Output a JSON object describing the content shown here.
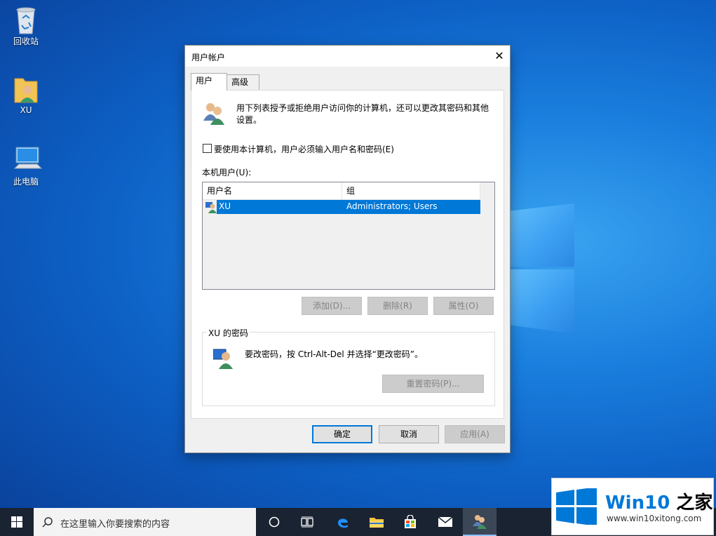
{
  "desktop": {
    "icons": [
      {
        "label": "回收站",
        "icon": "recycle-bin-icon"
      },
      {
        "label": "XU",
        "icon": "user-folder-icon"
      },
      {
        "label": "此电脑",
        "icon": "computer-icon"
      }
    ]
  },
  "dialog": {
    "title": "用户帐户",
    "close_glyph": "✕",
    "tabs": [
      {
        "label": "用户",
        "active": true
      },
      {
        "label": "高级",
        "active": false
      }
    ],
    "intro_text": "用下列表授予或拒绝用户访问你的计算机，还可以更改其密码和其他设置。",
    "require_password_checkbox": {
      "label": "要使用本计算机，用户必须输入用户名和密码(E)",
      "checked": false
    },
    "local_users_label": "本机用户(U):",
    "users_table": {
      "columns": [
        "用户名",
        "组"
      ],
      "rows": [
        {
          "username": "XU",
          "group": "Administrators; Users",
          "selected": true
        }
      ]
    },
    "user_buttons": {
      "add": "添加(D)...",
      "remove": "删除(R)",
      "properties": "属性(O)"
    },
    "password_group": {
      "title": "XU 的密码",
      "text": "要改密码，按 Ctrl-Alt-Del 并选择“更改密码”。",
      "reset_button": "重置密码(P)..."
    },
    "footer_buttons": {
      "ok": "确定",
      "cancel": "取消",
      "apply": "应用(A)"
    }
  },
  "taskbar": {
    "search_placeholder": "在这里输入你要搜索的内容"
  },
  "watermark": {
    "brand_prefix": "Win10",
    "brand_suffix": " 之家",
    "url": "www.win10xitong.com"
  }
}
